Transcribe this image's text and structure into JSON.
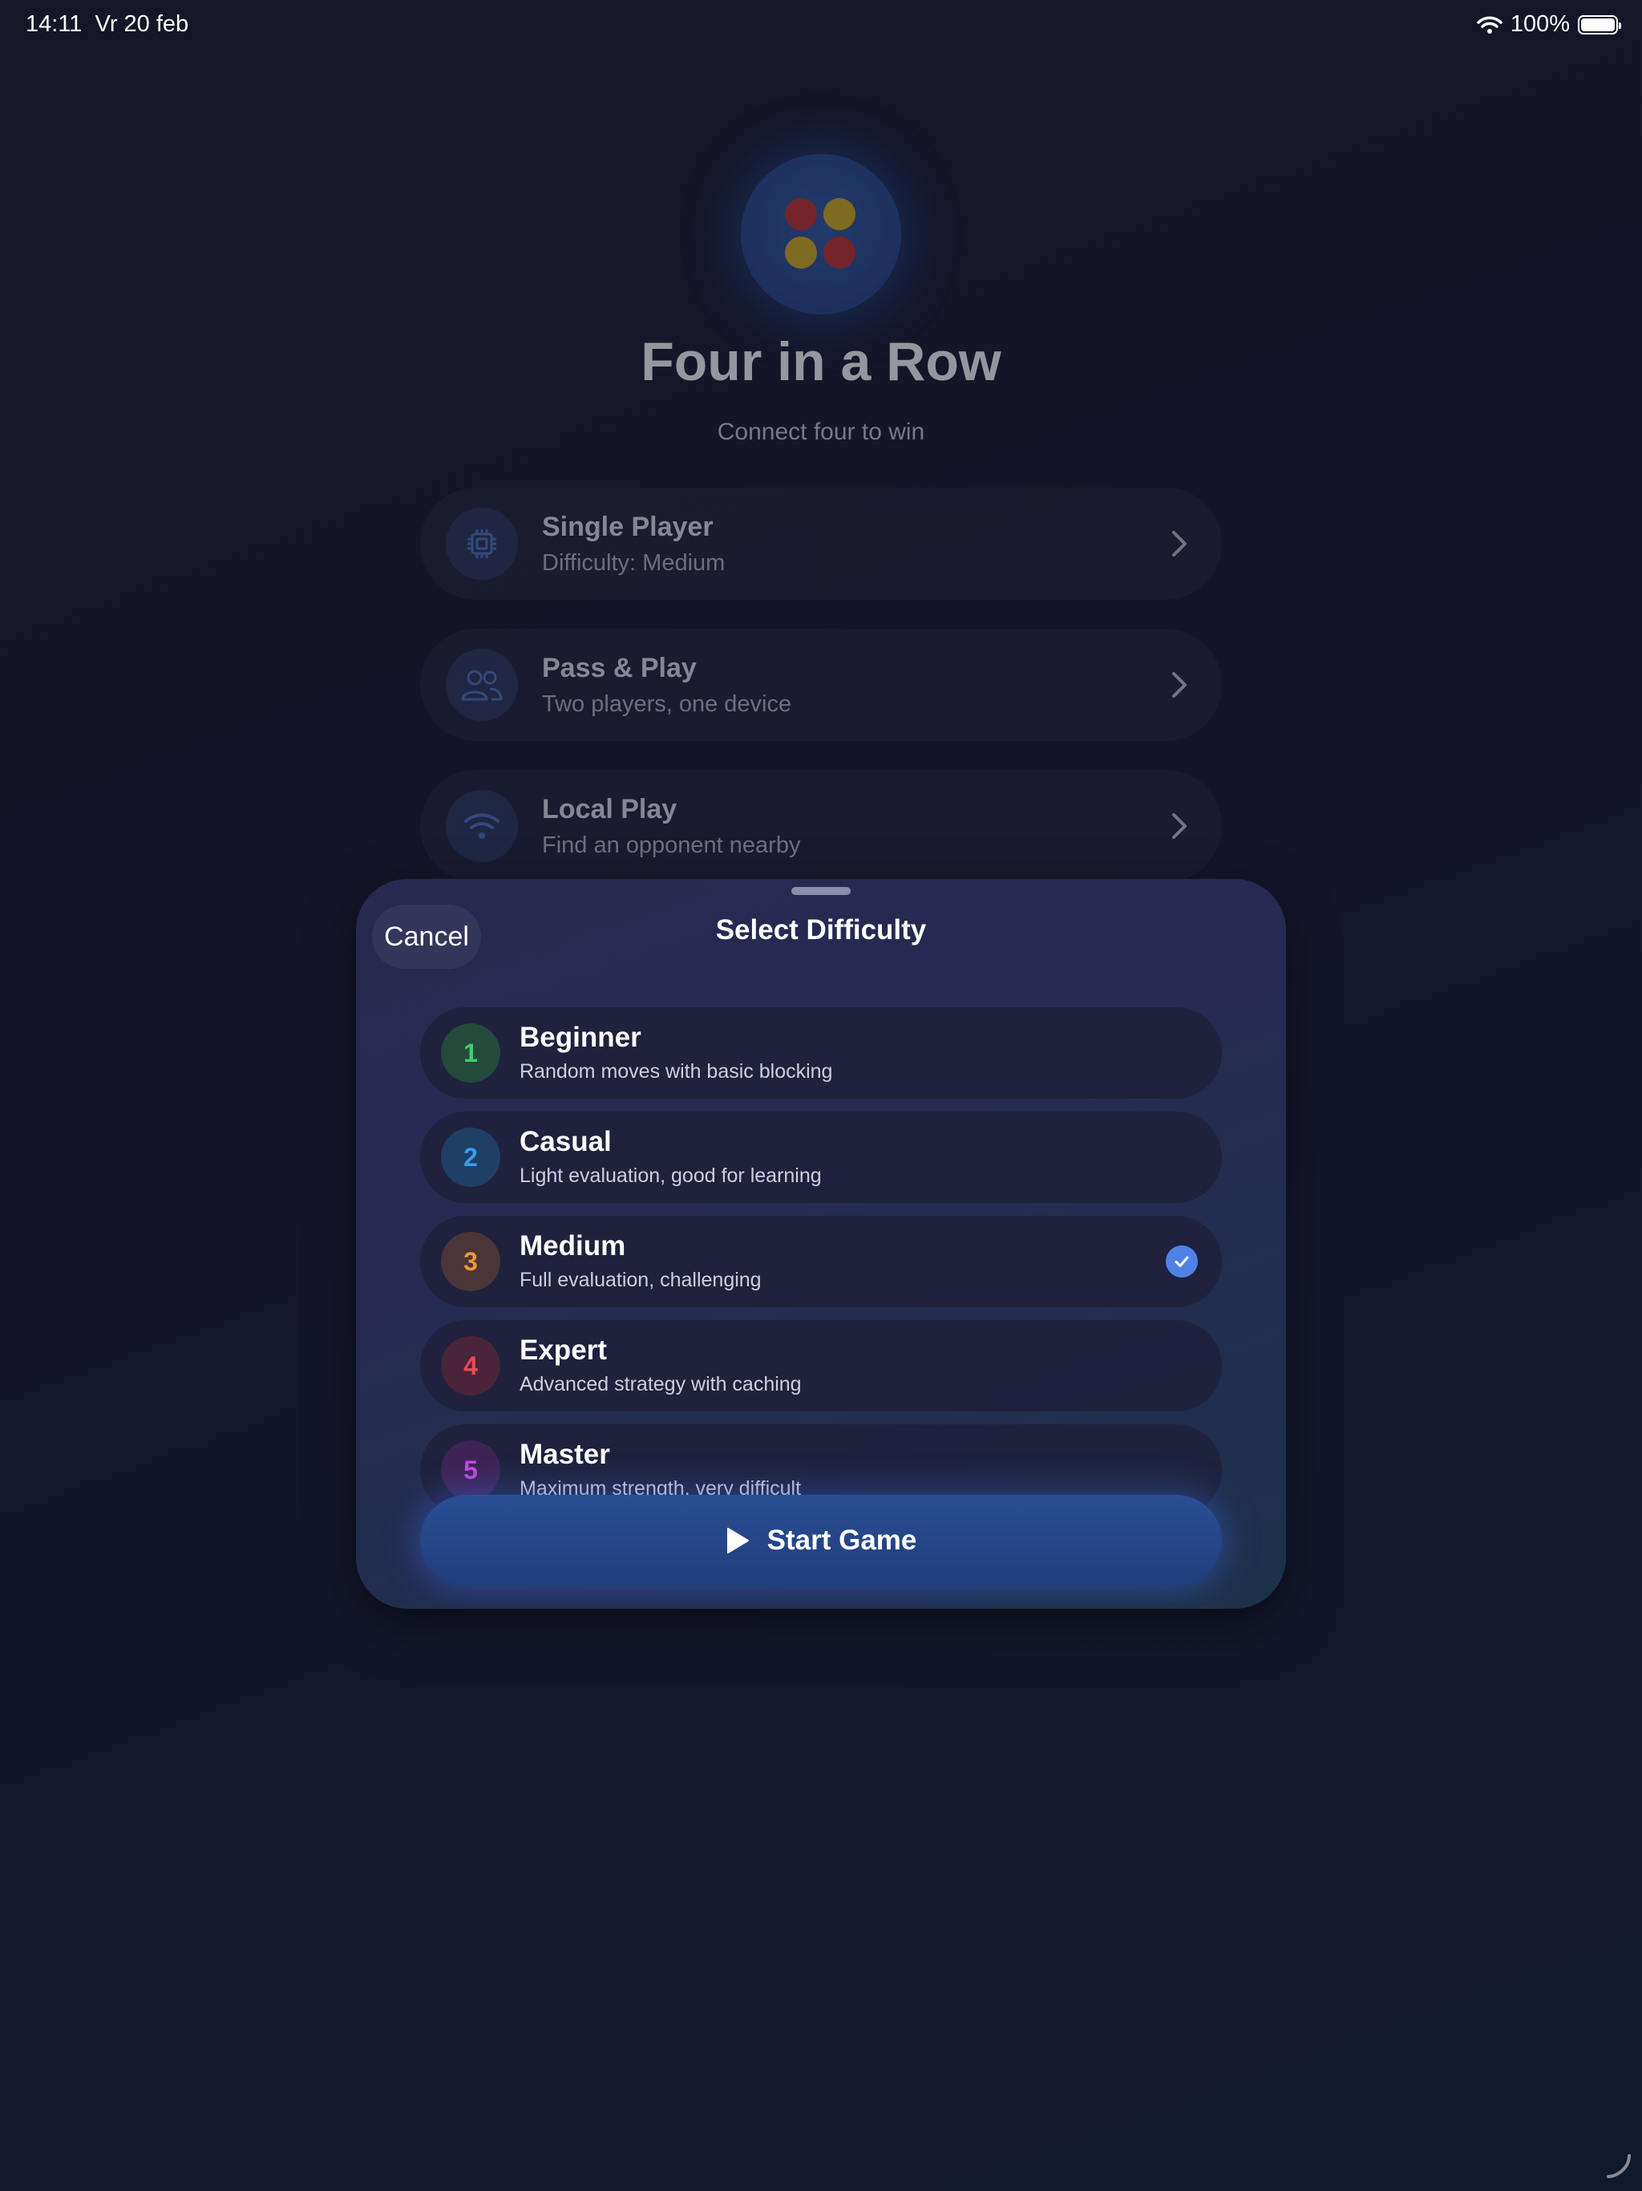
{
  "status_bar": {
    "time": "14:11",
    "date": "Vr 20 feb",
    "battery": "100%",
    "battery_level": 1.0
  },
  "home": {
    "title": "Four in a Row",
    "subtitle": "Connect four to win",
    "menu": [
      {
        "title": "Single Player",
        "subtitle": "Difficulty: Medium",
        "icon": "cpu-icon"
      },
      {
        "title": "Pass & Play",
        "subtitle": "Two players, one device",
        "icon": "two-people-icon"
      },
      {
        "title": "Local Play",
        "subtitle": "Find an opponent nearby",
        "icon": "wifi-icon"
      }
    ]
  },
  "sheet": {
    "cancel_label": "Cancel",
    "title": "Select Difficulty",
    "levels": [
      {
        "number": "1",
        "title": "Beginner",
        "subtitle": "Random moves with basic blocking",
        "color": "#3fcf6a",
        "bg": "#244a3c"
      },
      {
        "number": "2",
        "title": "Casual",
        "subtitle": "Light evaluation, good for learning",
        "color": "#3a9cf0",
        "bg": "#1f3f66"
      },
      {
        "number": "3",
        "title": "Medium",
        "subtitle": "Full evaluation, challenging",
        "color": "#f0953a",
        "bg": "#4a3638",
        "selected": true
      },
      {
        "number": "4",
        "title": "Expert",
        "subtitle": "Advanced strategy with caching",
        "color": "#e84a5a",
        "bg": "#4a2438"
      },
      {
        "number": "5",
        "title": "Master",
        "subtitle": "Maximum strength, very difficult",
        "color": "#c44ae0",
        "bg": "#3e2456"
      }
    ],
    "start_label": "Start Game"
  },
  "colors": {
    "accent": "#4f82e6",
    "start_button": "#244684"
  }
}
